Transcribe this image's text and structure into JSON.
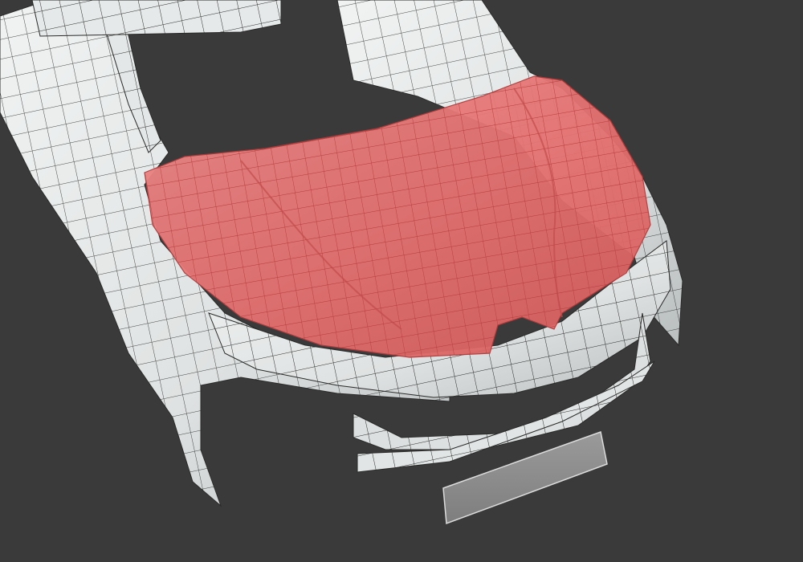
{
  "viewport": {
    "background": "#3a3a3a",
    "mesh_fill": "#e7eaea",
    "mesh_shade": "#bfc4c4",
    "wire_color": "#2a2a2a",
    "selection_fill": "#e36a6a",
    "selection_wire": "#b23a3a",
    "plate_fill": "#8c8c8c"
  },
  "scene": {
    "object": "car-body-mesh",
    "selected_part": "hood",
    "view": "3d-perspective"
  }
}
